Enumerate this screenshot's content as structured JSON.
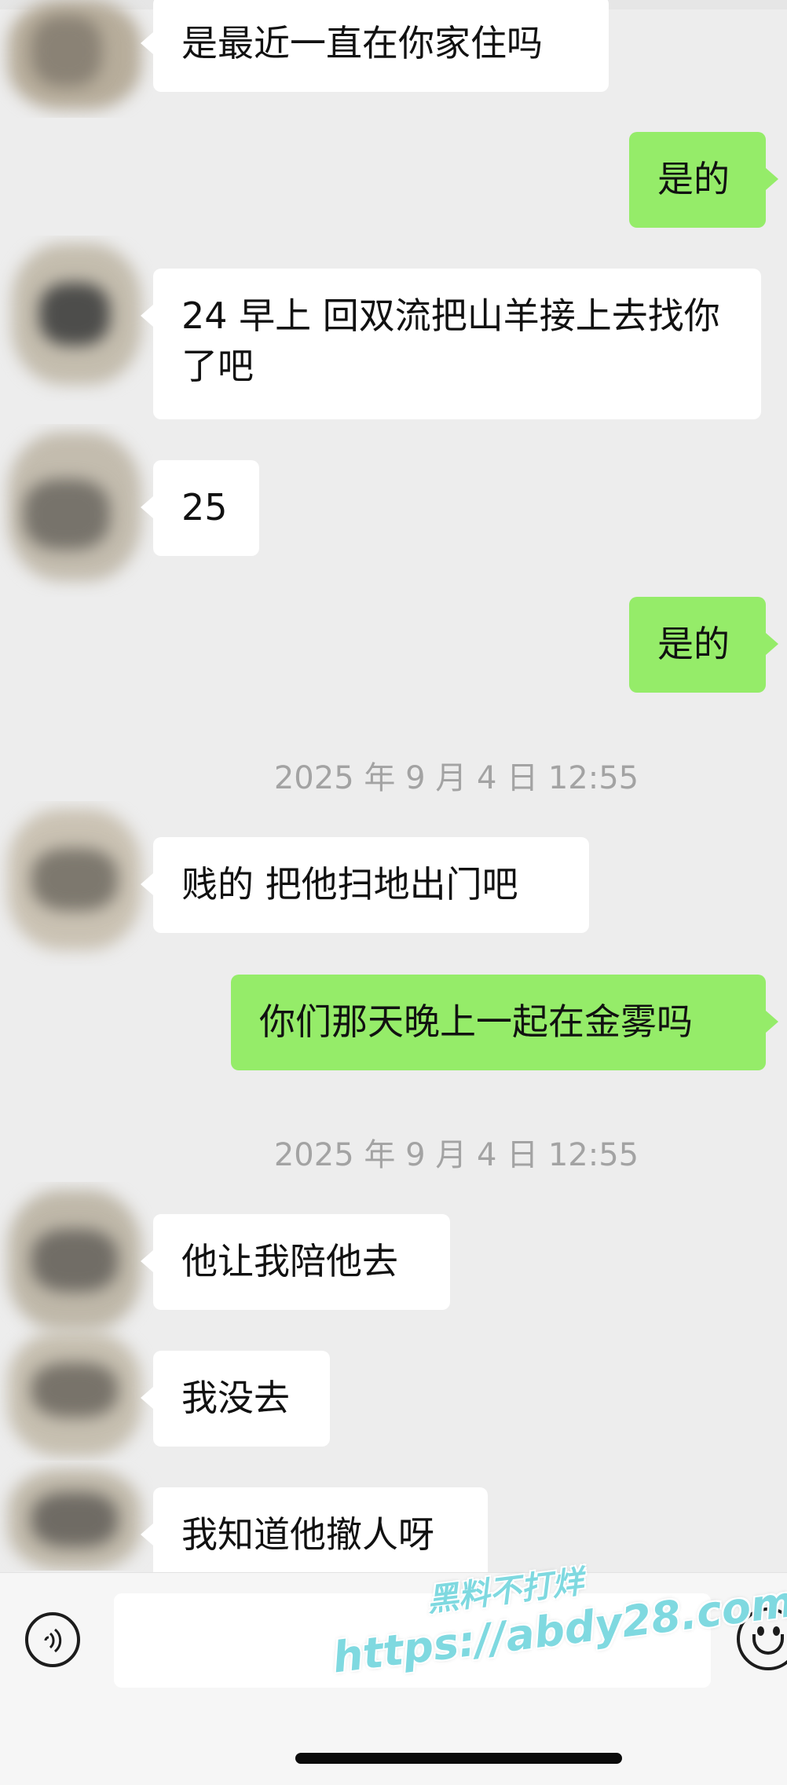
{
  "chat": {
    "messages": [
      {
        "from": "contact",
        "text": "是最近一直在你家住吗"
      },
      {
        "from": "me",
        "text": "是的"
      },
      {
        "from": "contact",
        "text": "24 早上  回双流把山羊接上去找你了吧"
      },
      {
        "from": "contact",
        "text": "25"
      },
      {
        "from": "me",
        "text": "是的"
      },
      {
        "type": "timestamp",
        "text": "2025 年 9 月 4 日 12:55"
      },
      {
        "from": "contact",
        "text": "贱的  把他扫地出门吧"
      },
      {
        "from": "me",
        "text": "你们那天晚上一起在金雾吗"
      },
      {
        "type": "timestamp",
        "text": "2025 年 9 月 4 日 12:55"
      },
      {
        "from": "contact",
        "text": "他让我陪他去"
      },
      {
        "from": "contact",
        "text": "我没去"
      },
      {
        "from": "contact",
        "text": "我知道他撤人呀"
      }
    ]
  },
  "input_bar": {
    "voice_icon": "voice-icon",
    "emoji_icon": "emoji-icon",
    "input_value": ""
  },
  "watermark": {
    "line1": "黑料不打烊",
    "line2": "https://abdy28.com"
  },
  "colors": {
    "background": "#ededed",
    "incoming_bubble": "#ffffff",
    "outgoing_bubble": "#95ec69",
    "timestamp_text": "#a3a3a3"
  }
}
